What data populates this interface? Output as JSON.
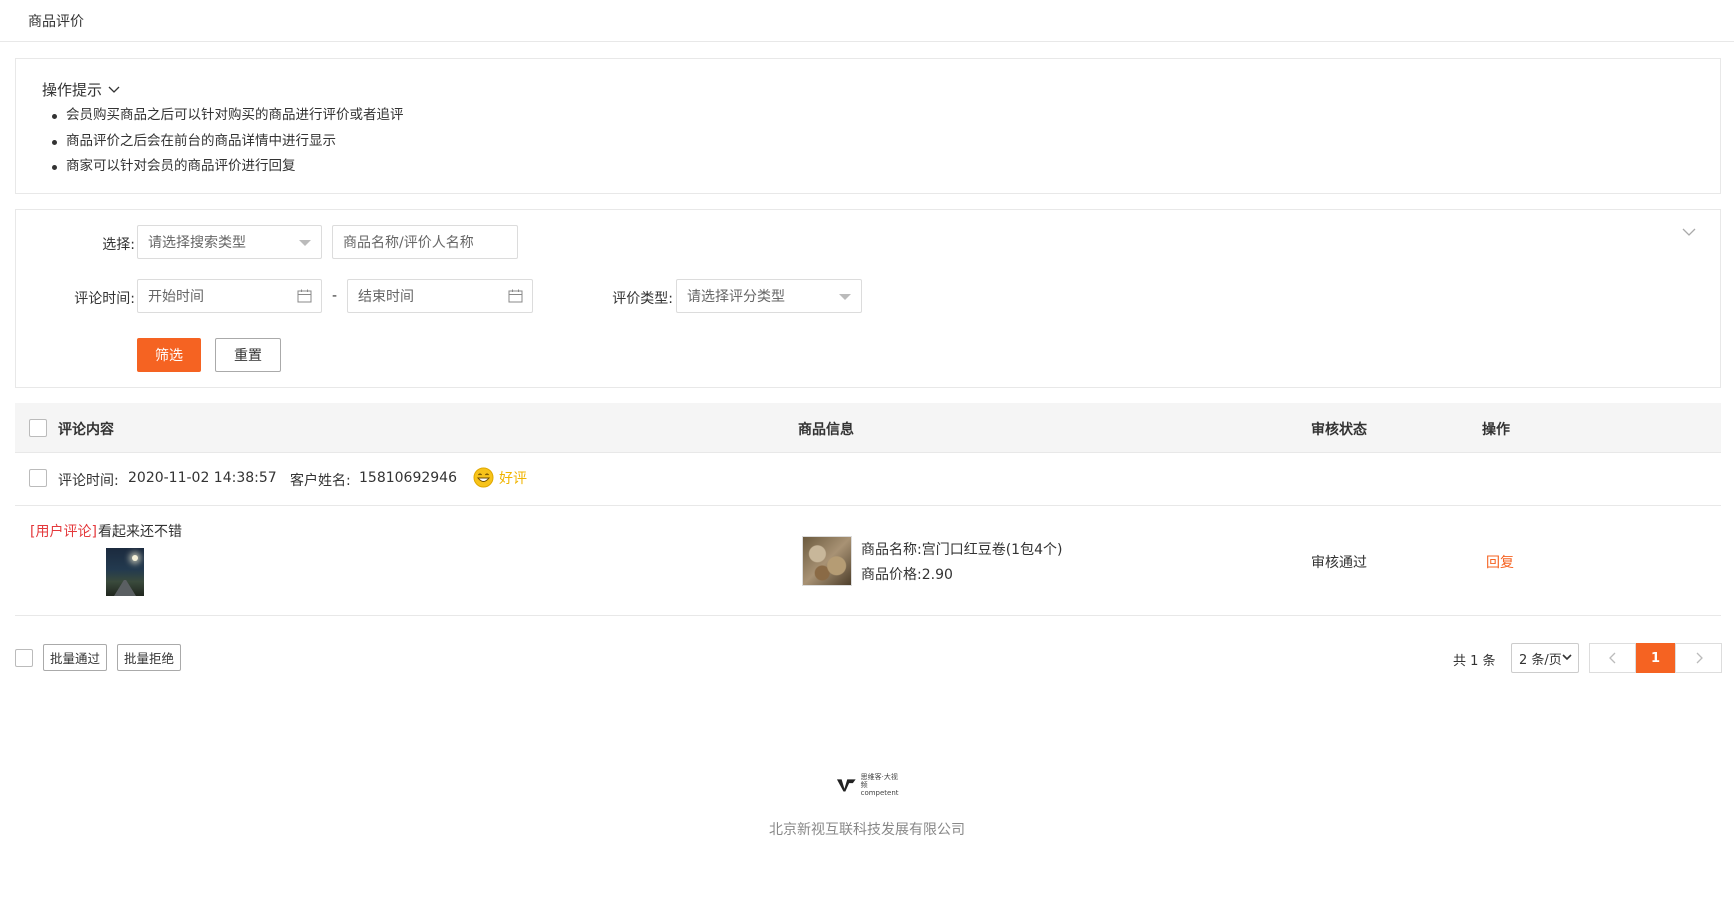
{
  "topbar": {
    "title": "商品评价"
  },
  "tips": {
    "heading": "操作提示",
    "items": [
      "会员购买商品之后可以针对购买的商品进行评价或者追评",
      "商品评价之后会在前台的商品详情中进行显示",
      "商家可以针对会员的商品评价进行回复"
    ]
  },
  "filter": {
    "select_label": "选择:",
    "search_type_placeholder": "请选择搜索类型",
    "keyword_placeholder": "商品名称/评价人名称",
    "time_label": "评论时间:",
    "start_placeholder": "开始时间",
    "range_separator": "-",
    "end_placeholder": "结束时间",
    "rating_label": "评价类型:",
    "rating_placeholder": "请选择评分类型",
    "filter_button": "筛选",
    "reset_button": "重置"
  },
  "table": {
    "headers": {
      "content": "评论内容",
      "product": "商品信息",
      "status": "审核状态",
      "action": "操作"
    },
    "rows": [
      {
        "comment_time_label": "评论时间:",
        "comment_time": "2020-11-02 14:38:57",
        "customer_label": "客户姓名:",
        "customer": "15810692946",
        "rating": "好评",
        "tag": "[用户评论]",
        "text": "看起来还不错",
        "product_name_label": "商品名称:",
        "product_name": "宫门口红豆卷(1包4个)",
        "product_price_label": "商品价格:",
        "product_price": "2.90",
        "status": "审核通过",
        "action": "回复"
      }
    ]
  },
  "bottom": {
    "batch_approve": "批量通过",
    "batch_reject": "批量拒绝",
    "total": "共 1 条",
    "page_size": "2 条/页",
    "current_page": "1"
  },
  "footer": {
    "logo_text_1": "思维客·大视频",
    "logo_text_2": "competent",
    "company": "北京新视互联科技发展有限公司"
  },
  "colors": {
    "accent": "#f56322",
    "user_tag": "#e4393c",
    "good_rating": "#f0b400"
  }
}
